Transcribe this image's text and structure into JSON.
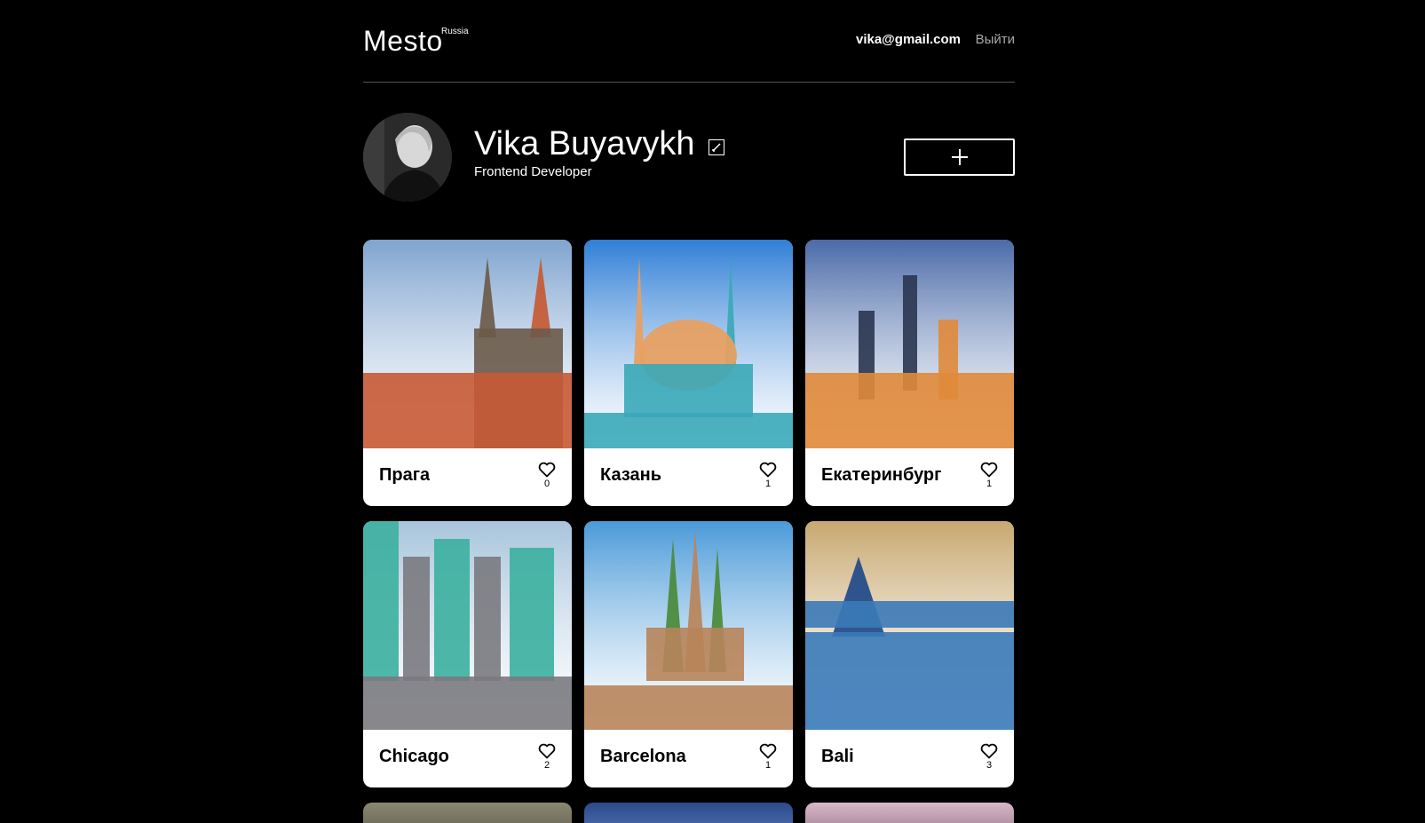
{
  "header": {
    "logo": "Mesto",
    "logo_sup": "Russia",
    "email": "vika@gmail.com",
    "logout": "Выйти"
  },
  "profile": {
    "name": "Vika Buyavykh",
    "about": "Frontend Developer",
    "icons": {
      "edit": "pencil-icon",
      "add": "plus-icon",
      "like": "heart-icon"
    }
  },
  "cards": [
    {
      "title": "Прага",
      "likes": "0",
      "palette": [
        "#7fa4cf",
        "#c65a34",
        "#6b5a4a"
      ]
    },
    {
      "title": "Казань",
      "likes": "1",
      "palette": [
        "#2f7fd6",
        "#3aa8b8",
        "#e8a060"
      ]
    },
    {
      "title": "Екатеринбург",
      "likes": "1",
      "palette": [
        "#4a6aa8",
        "#e08a3a",
        "#2a3550"
      ]
    },
    {
      "title": "Chicago",
      "likes": "2",
      "palette": [
        "#a8c4dc",
        "#7a7a80",
        "#3bb0a0"
      ]
    },
    {
      "title": "Barcelona",
      "likes": "1",
      "palette": [
        "#4a9ad8",
        "#b8845a",
        "#4a8a3a"
      ]
    },
    {
      "title": "Bali",
      "likes": "3",
      "palette": [
        "#c8a870",
        "#3a7ab8",
        "#1f4a8a"
      ]
    }
  ]
}
